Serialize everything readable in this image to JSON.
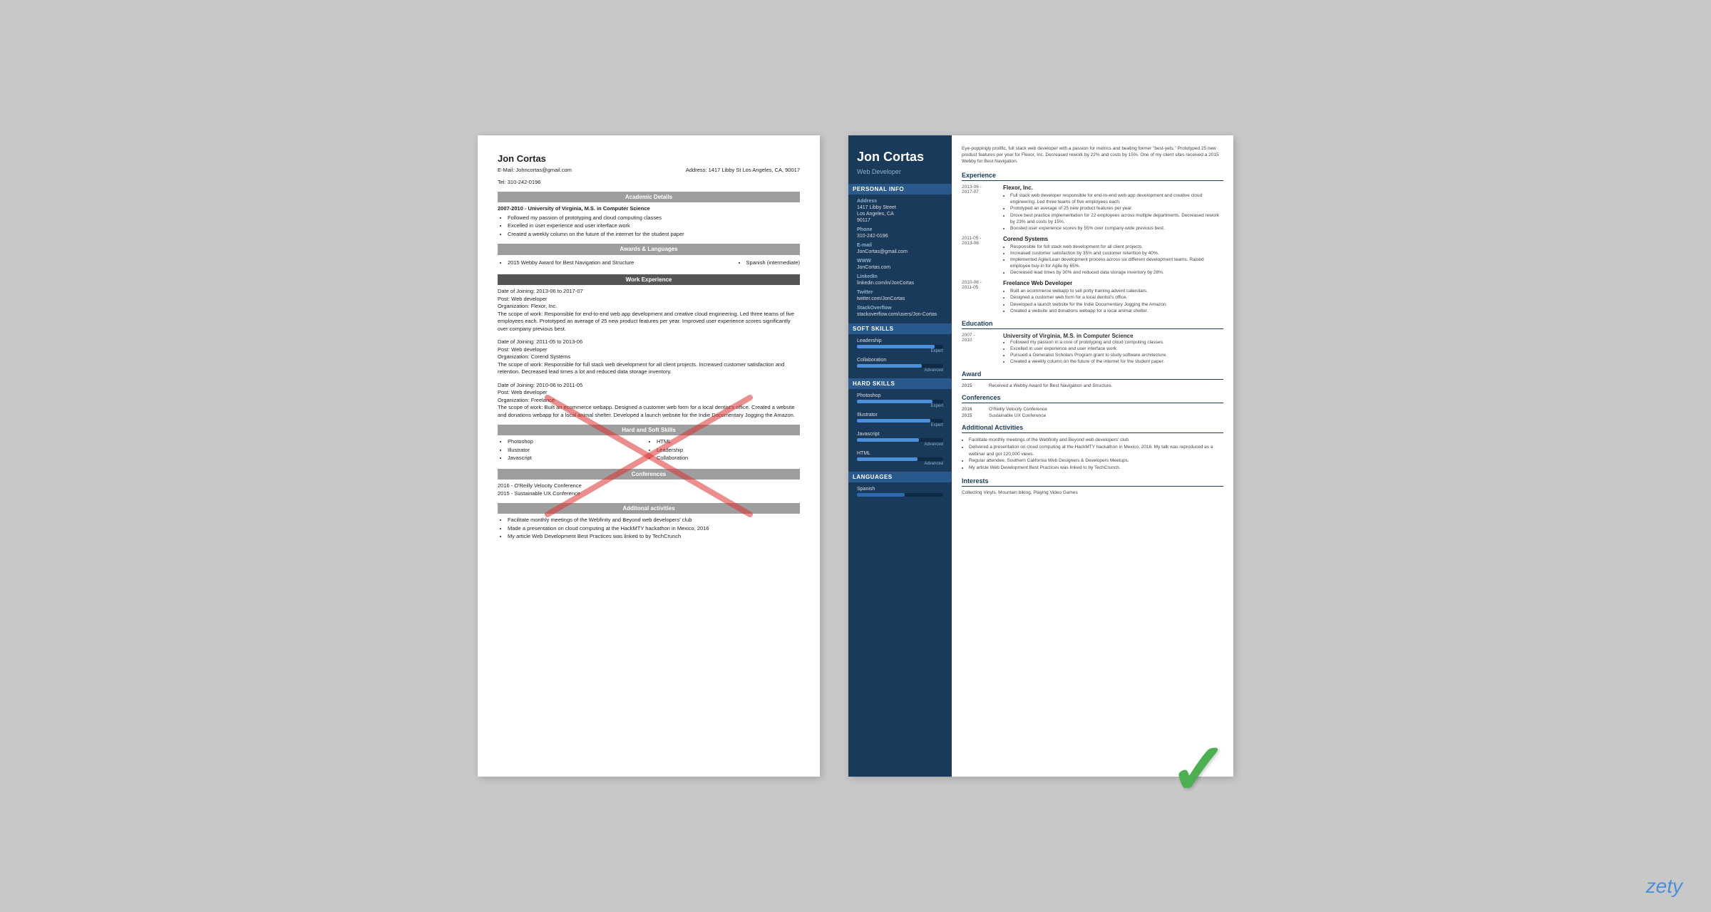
{
  "brand": "zety",
  "left_resume": {
    "name": "Jon Cortas",
    "email": "E-Mail: Johncortas@gmail.com",
    "tel": "Tel: 310-242-0196",
    "address_label": "Address:",
    "address": "1417 Libby St Los Angeles, CA, 90017",
    "academic_section": "Academic Details",
    "academic_item1": "2007-2010 - University of Virginia, M.S. in Computer Science",
    "academic_bullets": [
      "Followed my passion of prototyping and cloud computing classes",
      "Excelled in user experience and user interface work",
      "Created a weekly column on the future of the internet for the student paper"
    ],
    "awards_section": "Awards & Languages",
    "award1": "2015 Webby Award for Best Navigation and Structure",
    "language1": "Spanish (intermediate)",
    "work_section": "Work Experience",
    "job1_date": "Date of Joining: 2013-06 to 2017-07",
    "job1_post": "Post: Web developer",
    "job1_org": "Organization: Flexor, Inc.",
    "job1_scope": "The scope of work: Responsible for end-to-end web app development and creative cloud engineering. Led three teams of five employees each. Prototyped an average of 25 new product features per year. Improved user experience scores significantly over company previous best.",
    "job2_date": "Date of Joining: 2011-05 to 2013-06",
    "job2_post": "Post: Web developer",
    "job2_org": "Organization: Corend Systems",
    "job2_scope": "The scope of work: Responsible for full stack web development for all client projects. Increased customer satisfaction and retention. Decreased lead times a lot and reduced data storage inventory.",
    "job3_date": "Date of Joining: 2010-06 to 2011-05",
    "job3_post": "Post: Web developer",
    "job3_org": "Organization: Freelance",
    "job3_scope": "The scope of work: Built an ecommerce webapp. Designed a customer web form for a local dentist's office. Created a website and donations webapp for a local animal shelter. Developed a launch website for the Indie Documentary Jogging the Amazon.",
    "skills_section": "Hard and Soft Skills",
    "skills": [
      "Photoshop",
      "Illustrator",
      "Javascript",
      "HTML",
      "Leadership",
      "Collaboration"
    ],
    "conferences_section": "Conferences",
    "conf1": "2016 - O'Reilly Velocity Conference",
    "conf2": "2015 - Sustainable UX Conference",
    "activities_section": "Additonal activities",
    "act1": "Facilitate monthly meetings of the Webfinity and Beyond web developers' club",
    "act2": "Made a presentation on cloud computing at the HackMTY hackathon in Mexico, 2016",
    "act3": "My article Web Development Best Practices was linked to by TechCrunch"
  },
  "right_resume": {
    "name": "Jon Cortas",
    "title": "Web Developer",
    "summary": "Eye-poppingly prolific, full stack web developer with a passion for metrics and beating former \"best-yets.\" Prototyped 25 new product features per year for Flexor, Inc. Decreased rework by 22% and costs by 15%. One of my client sites received a 2015 Webby for Best Navigation.",
    "sidebar": {
      "personal_info_title": "Personal Info",
      "address_label": "Address",
      "address": "1417 Libby Street\nLos Angeles, CA\n90117",
      "phone_label": "Phone",
      "phone": "310-242-0196",
      "email_label": "E-mail",
      "email": "JonCortas@gmail.com",
      "www_label": "WWW",
      "www": "JonCortas.com",
      "linkedin_label": "LinkedIn",
      "linkedin": "linkedin.com/in/JonCortas",
      "twitter_label": "Twitter",
      "twitter": "twitter.com/JonCortas",
      "stackoverflow_label": "StackOverflow",
      "stackoverflow": "stackoverflow.com/users/Jon-Cortas",
      "soft_skills_title": "Soft Skills",
      "skills": [
        {
          "name": "Leadership",
          "level": "Expert",
          "pct": 90
        },
        {
          "name": "Collaboration",
          "level": "Advanced",
          "pct": 75
        }
      ],
      "hard_skills_title": "Hard Skills",
      "hard_skills": [
        {
          "name": "Photoshop",
          "level": "Expert",
          "pct": 88
        },
        {
          "name": "Illustrator",
          "level": "Expert",
          "pct": 85
        },
        {
          "name": "Javascript",
          "level": "Advanced",
          "pct": 72
        },
        {
          "name": "HTML",
          "level": "Advanced",
          "pct": 70
        }
      ],
      "languages_title": "Languages",
      "languages": [
        {
          "name": "Spanish",
          "pct": 55
        }
      ]
    },
    "experience_title": "Experience",
    "jobs": [
      {
        "date": "2013-06 -\n2017-07",
        "company": "Flexor, Inc.",
        "bullets": [
          "Full stack web developer responsible for end-to-end web app development and creative cloud engineering. Led three teams of five employees each.",
          "Prototyped an average of 25 new product features per year.",
          "Drove best practice implementation for 22 employees across multiple departments. Decreased rework by 23% and costs by 15%.",
          "Boosted user experience scores by 55% over company-wide previous best."
        ]
      },
      {
        "date": "2011-05 -\n2013-06",
        "company": "Corend Systems",
        "bullets": [
          "Responsible for full stack web development for all client projects.",
          "Increased customer satisfaction by 35% and customer retention by 40%.",
          "Implemented Agile/Lean development process across six different development teams. Raised employee buy-in for Agile by 65%.",
          "Decreased lead times by 30% and reduced data storage inventory by 28%."
        ]
      },
      {
        "date": "2010-06 -\n2011-05",
        "company": "Freelance Web Developer",
        "bullets": [
          "Built an ecommerce webapp to sell potty training advent calendars.",
          "Designed a customer web form for a local dentist's office.",
          "Developed a launch website for the Indie Documentary Jogging the Amazon.",
          "Created a website and donations webapp for a local animal shelter."
        ]
      }
    ],
    "education_title": "Education",
    "education": [
      {
        "date": "2007 -\n2010",
        "title": "University of Virginia, M.S. in Computer Science",
        "bullets": [
          "Followed my passion in a core of prototyping and cloud computing classes.",
          "Excelled in user experience and user interface work.",
          "Pursued a Generalist Scholars Program grant to study software architecture.",
          "Created a weekly column on the future of the internet for the student paper."
        ]
      }
    ],
    "award_title": "Award",
    "awards": [
      {
        "year": "2015",
        "text": "Received a Webby Award for Best Navigation and Structure."
      }
    ],
    "conferences_title": "Conferences",
    "conferences": [
      {
        "year": "2016",
        "name": "O'Reilly Velocity Conference"
      },
      {
        "year": "2015",
        "name": "Sustainable UX Conference"
      }
    ],
    "activities_title": "Additional Activities",
    "activities": [
      "Facilitate monthly meetings of the Webfinity and Beyond web developers' club.",
      "Delivered a presentation on cloud computing at the HackMTY hackathon in Mexico, 2016. My talk was reproduced as a webinar and got 120,000 views.",
      "Regular attendee, Southern California Web Designers & Developers Meetups.",
      "My article Web Development Best Practices was linked to by TechCrunch."
    ],
    "interests_title": "Interests",
    "interests": "Collecting Vinyls, Mountain biking, Playing Video Games"
  }
}
